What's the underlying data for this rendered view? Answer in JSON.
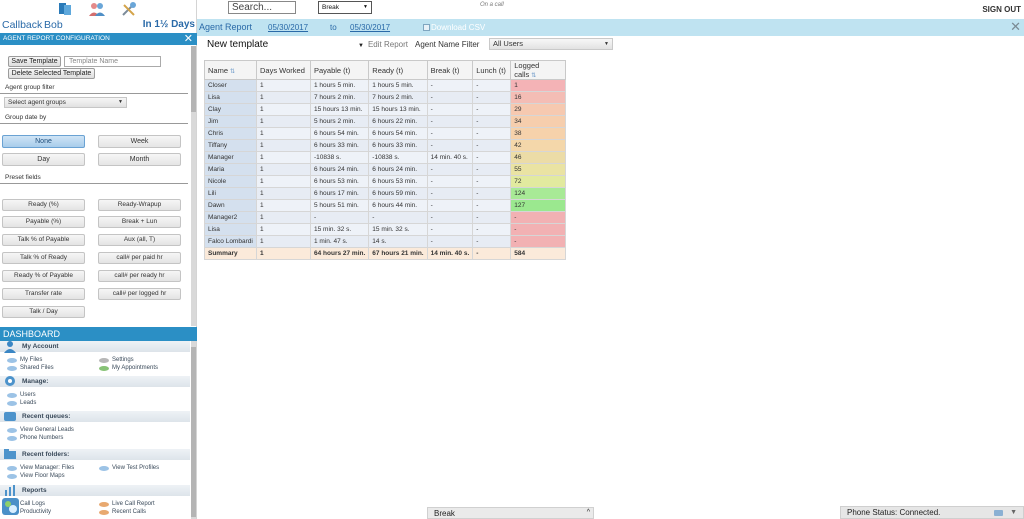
{
  "sidebar": {
    "user": {
      "callback_label": "Callback",
      "name": "Bob",
      "days": "In 1½ Days"
    },
    "config": {
      "header": "AGENT REPORT CONFIGURATION",
      "close": "✕",
      "save_template": "Save Template",
      "template_name_placeholder": "Template Name",
      "delete_template": "Delete Selected Template",
      "agent_group_filter_label": "Agent group filter",
      "agent_group_select": "Select agent groups",
      "group_date_by_label": "Group date by",
      "group_buttons": [
        "None",
        "Week",
        "Day",
        "Month"
      ],
      "preset_fields_label": "Preset fields",
      "preset_fields": [
        "Ready (%)",
        "Ready-Wrapup",
        "Payable (%)",
        "Break + Lun",
        "Talk % of Payable",
        "Aux (all, T)",
        "Talk % of Ready",
        "call# per paid hr",
        "Ready % of Payable",
        "call# per ready hr",
        "Transfer rate",
        "call# per logged hr",
        "Talk / Day"
      ]
    },
    "dashboard": {
      "header": "DASHBOARD",
      "sections": [
        {
          "title": "My Account",
          "links": [
            "My Files",
            "Settings",
            "Shared Files",
            "My Appointments"
          ]
        },
        {
          "title": "Manage:",
          "links": [
            "Users",
            "Leads"
          ]
        },
        {
          "title": "Recent queues:",
          "links": [
            "View General Leads",
            "Phone Numbers"
          ]
        },
        {
          "title": "Recent folders:",
          "links": [
            "View Manager: Files",
            "View Test Profiles",
            "View Floor Maps"
          ]
        },
        {
          "title": "Reports",
          "links": [
            "Call Logs",
            "Live Call Report",
            "Productivity",
            "Recent Calls"
          ]
        }
      ]
    }
  },
  "topbar": {
    "search_placeholder": "Search...",
    "status": "Break",
    "oncall": "On a call",
    "signout": "SIGN OUT"
  },
  "report": {
    "title": "Agent Report",
    "date_from": "05/30/2017",
    "to": "to",
    "date_to": "05/30/2017",
    "download": "Download CSV",
    "template_name": "New template",
    "edit_report": "Edit Report",
    "agent_filter_label": "Agent Name Filter",
    "agent_filter_value": "All Users",
    "columns": [
      "Name",
      "Days Worked",
      "Payable (t)",
      "Ready (t)",
      "Break (t)",
      "Lunch (t)",
      "Logged calls"
    ],
    "rows": [
      [
        "Closer",
        "1",
        "1 hours 5 min.",
        "1 hours 5 min.",
        "-",
        "-",
        "1"
      ],
      [
        "Lisa",
        "1",
        "7 hours 2 min.",
        "7 hours 2 min.",
        "-",
        "-",
        "16"
      ],
      [
        "Clay",
        "1",
        "15 hours 13 min.",
        "15 hours 13 min.",
        "-",
        "-",
        "29"
      ],
      [
        "Jim",
        "1",
        "5 hours 2 min.",
        "6 hours 22 min.",
        "-",
        "-",
        "34"
      ],
      [
        "Chris",
        "1",
        "6 hours 54 min.",
        "6 hours 54 min.",
        "-",
        "-",
        "38"
      ],
      [
        "Tiffany",
        "1",
        "6 hours 33 min.",
        "6 hours 33 min.",
        "-",
        "-",
        "42"
      ],
      [
        "Manager",
        "1",
        "-10838 s.",
        "-10838 s.",
        "14 min. 40 s.",
        "-",
        "46"
      ],
      [
        "Maria",
        "1",
        "6 hours 24 min.",
        "6 hours 24 min.",
        "-",
        "-",
        "55"
      ],
      [
        "Nicole",
        "1",
        "6 hours 53 min.",
        "6 hours 53 min.",
        "-",
        "-",
        "72"
      ],
      [
        "Lili",
        "1",
        "6 hours 17 min.",
        "6 hours 59 min.",
        "-",
        "-",
        "124"
      ],
      [
        "Dawn",
        "1",
        "5 hours 51 min.",
        "6 hours 44 min.",
        "-",
        "-",
        "127"
      ],
      [
        "Manager2",
        "1",
        "-",
        "-",
        "-",
        "-",
        "-"
      ],
      [
        "Lisa",
        "1",
        "15 min. 32 s.",
        "15 min. 32 s.",
        "-",
        "-",
        "-"
      ],
      [
        "Falco Lombardi",
        "1",
        "1 min. 47 s.",
        "14 s.",
        "-",
        "-",
        "-"
      ]
    ],
    "summary": [
      "Summary",
      "1",
      "64 hours 27 min.",
      "67 hours 21 min.",
      "14 min. 40 s.",
      "-",
      "584"
    ],
    "logged_colors": [
      "#f4b3b6",
      "#f4bdb5",
      "#f6c9b0",
      "#f6cead",
      "#f6d2ab",
      "#f4d7aa",
      "#ecdca7",
      "#eae3a3",
      "#e2ea9f",
      "#a8ea96",
      "#9be88f",
      "#f2b1b3",
      "#f2b1b3",
      "#f2b1b3"
    ]
  },
  "bottom": {
    "status": "Break",
    "phone_status": "Phone Status: Connected."
  },
  "colors": {
    "accent": "#2b8fc5",
    "report_bar": "#bfe3f1",
    "link": "#2a6aa8"
  }
}
